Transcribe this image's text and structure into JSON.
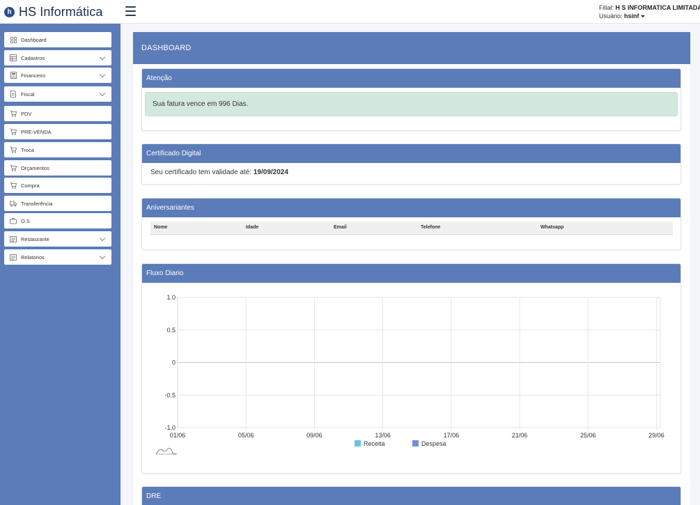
{
  "brand": {
    "name": "HS Informática",
    "logo_letter": "h"
  },
  "user": {
    "filial_label": "Filial:",
    "filial_value": "H S INFORMATICA LIMITADA",
    "usuario_label": "Usuário:",
    "usuario_value": "hsinf"
  },
  "sidebar": {
    "items": [
      {
        "label": "Dashboard",
        "icon": "grid-icon",
        "chevron": false
      },
      {
        "label": "Cadastros",
        "icon": "table-icon",
        "chevron": true
      },
      {
        "label": "Financeiro",
        "icon": "calculator-icon",
        "chevron": true
      },
      {
        "label": "Fiscal",
        "icon": "document-icon",
        "chevron": true
      },
      {
        "label": "PDV",
        "icon": "cart-icon",
        "chevron": false
      },
      {
        "label": "PRE-VENDA",
        "icon": "cart-icon",
        "chevron": false
      },
      {
        "label": "Troca",
        "icon": "cart-icon",
        "chevron": false
      },
      {
        "label": "Orçamentos",
        "icon": "cart-icon",
        "chevron": false
      },
      {
        "label": "Compra",
        "icon": "cart-icon",
        "chevron": false
      },
      {
        "label": "Transferência",
        "icon": "truck-icon",
        "chevron": false
      },
      {
        "label": "O.S",
        "icon": "briefcase-icon",
        "chevron": false
      },
      {
        "label": "Restaurante",
        "icon": "list-icon",
        "chevron": true
      },
      {
        "label": "Relatorios",
        "icon": "list-icon",
        "chevron": true
      }
    ]
  },
  "main": {
    "title": "DASHBOARD",
    "atencao": {
      "title": "Atenção",
      "message": "Sua fatura vence em 996 Dias."
    },
    "certificado": {
      "title": "Certificado Digital",
      "text": "Seu certificado tem validade até: ",
      "date": "19/09/2024"
    },
    "aniversariantes": {
      "title": "Aniversariantes",
      "columns": [
        "Nome",
        "Idade",
        "Email",
        "Telefone",
        "Whatsapp"
      ]
    },
    "fluxo": {
      "title": "Fluxo Diario"
    },
    "dre": {
      "title": "DRE"
    }
  },
  "chart_data": {
    "type": "line",
    "title": "",
    "x": [
      "01/06",
      "05/06",
      "09/06",
      "13/06",
      "17/06",
      "21/06",
      "25/06",
      "29/06"
    ],
    "yticks": [
      "1.0",
      "0.5",
      "0",
      "-0.5",
      "-1.0"
    ],
    "ylim": [
      -1,
      1
    ],
    "grid": true,
    "legend_position": "bottom",
    "series": [
      {
        "name": "Receita",
        "color": "#6ec1e4",
        "values": []
      },
      {
        "name": "Despesa",
        "color": "#6f8fd6",
        "values": []
      }
    ]
  }
}
